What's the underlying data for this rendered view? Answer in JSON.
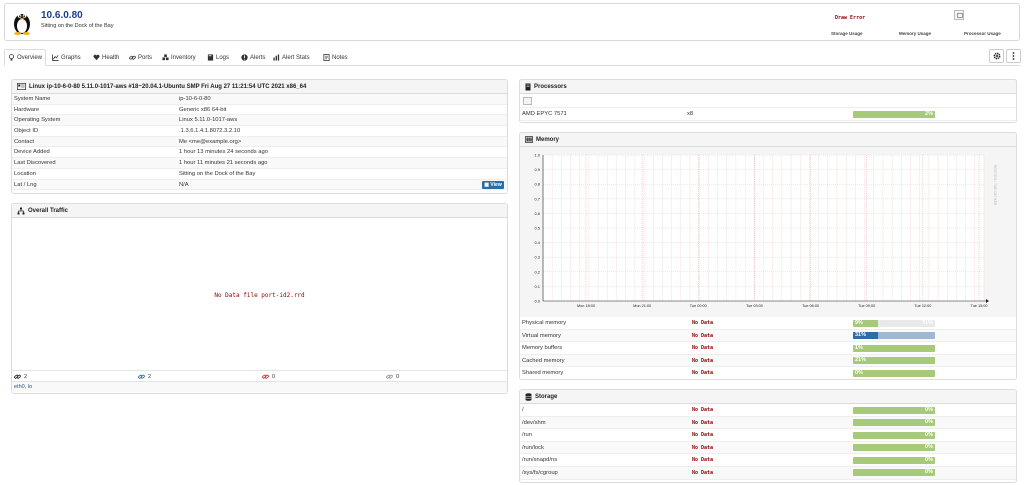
{
  "header": {
    "title": "10.6.0.80",
    "subtitle": "Sitting on the Dock of the Bay",
    "draw_error": "Draw Error",
    "storage_label": "Storage Usage",
    "memory_label": "Memory Usage",
    "processor_label": "Processor Usage"
  },
  "tabs": [
    {
      "label": "Overview",
      "icon": "lightbulb-icon"
    },
    {
      "label": "Graphs",
      "icon": "chart-icon"
    },
    {
      "label": "Health",
      "icon": "heart-icon"
    },
    {
      "label": "Ports",
      "icon": "link-icon"
    },
    {
      "label": "Inventory",
      "icon": "cubes-icon"
    },
    {
      "label": "Logs",
      "icon": "book-icon"
    },
    {
      "label": "Alerts",
      "icon": "alert-icon"
    },
    {
      "label": "Alert Stats",
      "icon": "bar-chart-icon"
    },
    {
      "label": "Notes",
      "icon": "note-icon"
    }
  ],
  "overview": {
    "title": "Linux ip-10-6-0-80 5.11.0-1017-aws #18~20.04.1-Ubuntu SMP Fri Aug 27 11:21:54 UTC 2021 x86_64",
    "rows": [
      {
        "key": "System Name",
        "value": "ip-10-6-0-80"
      },
      {
        "key": "Hardware",
        "value": "Generic x86 64-bit"
      },
      {
        "key": "Operating System",
        "value": "Linux 5.11.0-1017-aws"
      },
      {
        "key": "Object ID",
        "value": ".1.3.6.1.4.1.8072.3.2.10"
      },
      {
        "key": "Contact",
        "value": "Me <me@example.org>"
      },
      {
        "key": "Device Added",
        "value": "1 hour 13 minutes 24 seconds ago"
      },
      {
        "key": "Last Discovered",
        "value": "1 hour 11 minutes 21 seconds ago"
      },
      {
        "key": "Location",
        "value": "Sitting on the Dock of the Bay"
      },
      {
        "key": "Lat / Lng",
        "value": "N/A"
      }
    ],
    "view_button": "View"
  },
  "traffic": {
    "title": "Overall Traffic",
    "no_data": "No Data file port-id2.rrd",
    "ports_total": "2",
    "ports_up": "2",
    "ports_down": "0",
    "ports_disabled": "0",
    "interfaces": "eth0, lo"
  },
  "processors": {
    "title": "Processors",
    "rows": [
      {
        "name": "AMD EPYC 7571",
        "count": "x8",
        "usage": "2%",
        "usage_value": 2
      }
    ]
  },
  "memory": {
    "title": "Memory",
    "rows": [
      {
        "name": "Physical memory",
        "status": "No Data",
        "left": "9%",
        "right": "31%",
        "value": 31,
        "color": "#a7c97a"
      },
      {
        "name": "Virtual memory",
        "status": "No Data",
        "left": "31%",
        "right": "",
        "value": 31,
        "color": "#2e6da4"
      },
      {
        "name": "Memory buffers",
        "status": "No Data",
        "left": "1%",
        "right": "",
        "value": 1,
        "color": "#a7c97a"
      },
      {
        "name": "Cached memory",
        "status": "No Data",
        "left": "21%",
        "right": "",
        "value": 21,
        "color": "#a7c97a"
      },
      {
        "name": "Shared memory",
        "status": "No Data",
        "left": "0%",
        "right": "",
        "value": 0,
        "color": "#a7c97a"
      }
    ]
  },
  "storage": {
    "title": "Storage",
    "rows": [
      {
        "name": "/",
        "status": "No Data",
        "usage": "0%"
      },
      {
        "name": "/dev/shm",
        "status": "No Data",
        "usage": "0%"
      },
      {
        "name": "/run",
        "status": "No Data",
        "usage": "0%"
      },
      {
        "name": "/run/lock",
        "status": "No Data",
        "usage": "0%"
      },
      {
        "name": "/run/snapd/ns",
        "status": "No Data",
        "usage": "0%"
      },
      {
        "name": "/sys/fs/cgroup",
        "status": "No Data",
        "usage": "0%"
      }
    ]
  },
  "chart_data": {
    "type": "line",
    "title": "",
    "xlabel": "",
    "ylabel": "",
    "ylim": [
      0,
      1
    ],
    "yticks": [
      "0.0",
      "0.1",
      "0.2",
      "0.3",
      "0.4",
      "0.5",
      "0.6",
      "0.7",
      "0.8",
      "0.9",
      "1.0"
    ],
    "xticks": [
      "Mon 18:00",
      "Mon 21:00",
      "Tue 00:00",
      "Tue 03:00",
      "Tue 06:00",
      "Tue 09:00",
      "Tue 12:00",
      "Tue 15:00"
    ],
    "series": [],
    "grid": true,
    "watermark": "RRDTOOL / TOBI OETIKER"
  },
  "colors": {
    "accent": "#2e6da4",
    "bar_green": "#a7c97a",
    "error_red": "#8b0000",
    "link_blue": "#1a3d8a"
  }
}
